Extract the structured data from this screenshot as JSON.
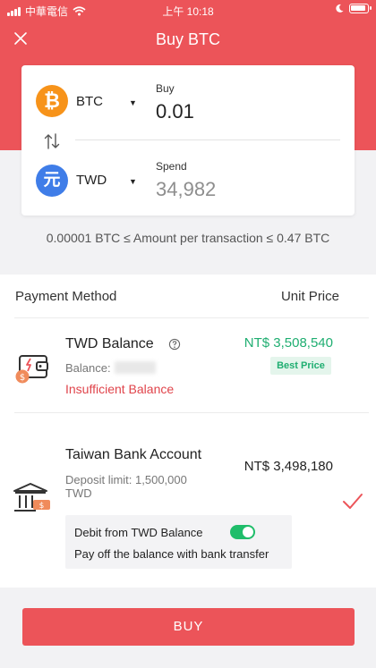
{
  "statusbar": {
    "carrier": "中華電信",
    "time": "上午 10:18"
  },
  "header": {
    "title": "Buy BTC",
    "close_icon": "close-icon"
  },
  "trade": {
    "from": {
      "code": "BTC",
      "icon_glyph": "₿",
      "icon_color": "#f7931a",
      "field_label": "Buy",
      "value": "0.01"
    },
    "to": {
      "code": "TWD",
      "icon_glyph": "元",
      "icon_color": "#3f7de8",
      "field_label": "Spend",
      "value": "34,982"
    },
    "limit_text": "0.00001 BTC ≤ Amount per transaction ≤ 0.47 BTC"
  },
  "payment": {
    "header_left": "Payment Method",
    "header_right": "Unit Price",
    "methods": [
      {
        "title": "TWD Balance",
        "balance_label": "Balance:",
        "status": "Insufficient Balance",
        "price": "NT$ 3,508,540",
        "badge": "Best Price",
        "icon": "wallet-icon"
      },
      {
        "title": "Taiwan Bank Account",
        "limit_text": "Deposit limit: 1,500,000 TWD",
        "price": "NT$ 3,498,180",
        "selected": true,
        "debit_label": "Debit from TWD Balance",
        "debit_enabled": true,
        "debit_sub": "Pay off the balance with bank transfer",
        "icon": "bank-icon"
      }
    ]
  },
  "actions": {
    "buy_label": "BUY"
  },
  "colors": {
    "brand": "#ec5459",
    "success": "#1fae71",
    "error": "#e0444b"
  }
}
